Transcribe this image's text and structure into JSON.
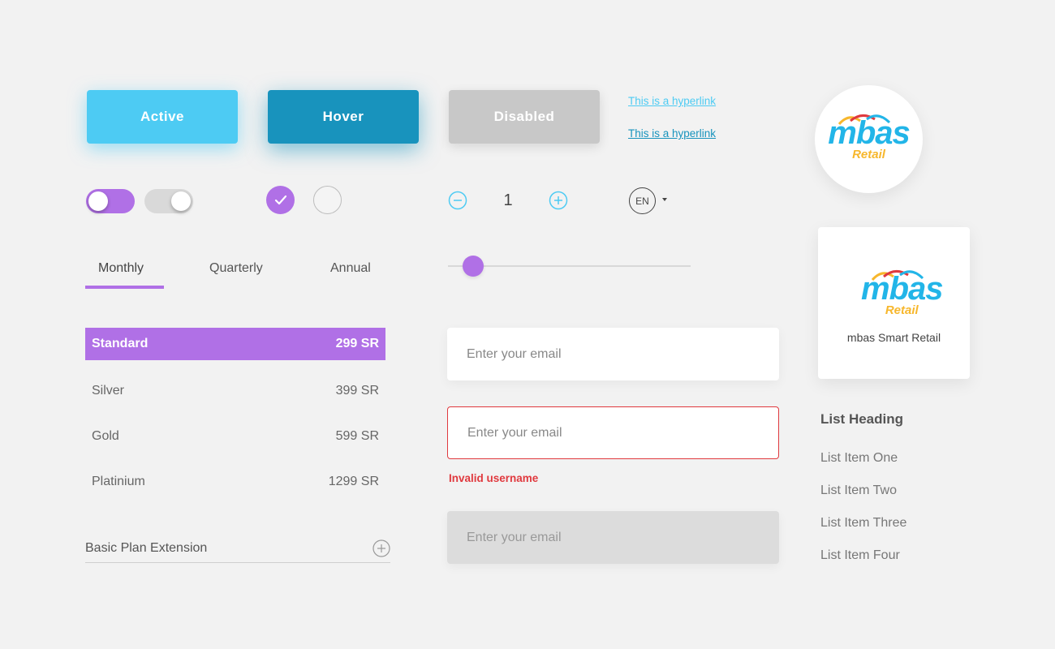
{
  "buttons": {
    "active": "Active",
    "hover": "Hover",
    "disabled": "Disabled"
  },
  "links": [
    "This is a hyperlink",
    "This is a hyperlink"
  ],
  "brand": {
    "logo_main": "mbas",
    "logo_sub": "Retail",
    "card_title": "mbas Smart Retail"
  },
  "stepper": {
    "value": "1"
  },
  "language": {
    "selected": "EN"
  },
  "tabs": [
    {
      "label": "Monthly",
      "selected": true
    },
    {
      "label": "Quarterly",
      "selected": false
    },
    {
      "label": "Annual",
      "selected": false
    }
  ],
  "slider": {
    "value_fraction": 0.1
  },
  "plans": [
    {
      "name": "Standard",
      "price": "299 SR",
      "selected": true
    },
    {
      "name": "Silver",
      "price": "399 SR",
      "selected": false
    },
    {
      "name": "Gold",
      "price": "599 SR",
      "selected": false
    },
    {
      "name": "Platinium",
      "price": "1299 SR",
      "selected": false
    }
  ],
  "extension": {
    "label": "Basic Plan Extension"
  },
  "inputs": {
    "placeholder": "Enter your email",
    "error_message": "Invalid username"
  },
  "list": {
    "heading": "List Heading",
    "items": [
      "List Item One",
      "List Item Two",
      "List Item Three",
      "List Item Four"
    ]
  },
  "colors": {
    "primary_purple": "#b070e6",
    "active_blue": "#4dcbf3",
    "hover_blue": "#1893bd",
    "error_red": "#e0393e",
    "logo_orange": "#f7b72c"
  }
}
